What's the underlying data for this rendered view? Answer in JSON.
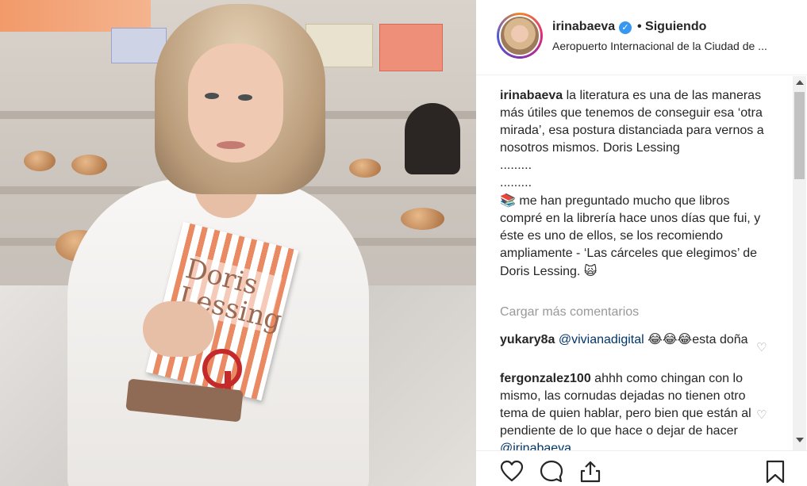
{
  "post": {
    "username": "irinabaeva",
    "following_label": "• Siguiendo",
    "location": "Aeropuerto Internacional de la Ciudad de ...",
    "verified_glyph": "✓"
  },
  "photo": {
    "book_title": "Doris Lessing"
  },
  "caption": {
    "username": "irinabaeva",
    "text": "la literatura es una de las maneras más útiles que tenemos de conseguir esa ‘otra mirada’, esa postura distanciada para vernos a nosotros mismos. Doris Lessing",
    "dots1": ".........",
    "dots2": ".........",
    "books_emoji": "📚",
    "text2": "me han preguntado mucho que libros compré en la librería hace unos días que fui, y éste es uno de ellos, se los recomiendo ampliamente - ‘Las cárceles que elegimos’ de Doris Lessing.",
    "end_emoji": "🙀"
  },
  "load_more_label": "Cargar más comentarios",
  "comments": [
    {
      "username": "yukary8a",
      "mention": "@vivianadigital",
      "emojis": "😂😂😂",
      "text": "esta doña"
    },
    {
      "username": "fergonzalez100",
      "text": "ahhh como chingan con lo mismo, las cornudas dejadas no tienen otro tema de quien hablar, pero bien que están al pendiente de lo que hace o dejar de hacer",
      "mention": "@irinabaeva"
    }
  ],
  "icons": {
    "like": "heart-icon",
    "comment": "comment-icon",
    "share": "share-icon",
    "save": "bookmark-icon",
    "comment_like": "♡"
  },
  "colors": {
    "verified": "#3897f0",
    "mention": "#003569",
    "muted": "#999999"
  }
}
